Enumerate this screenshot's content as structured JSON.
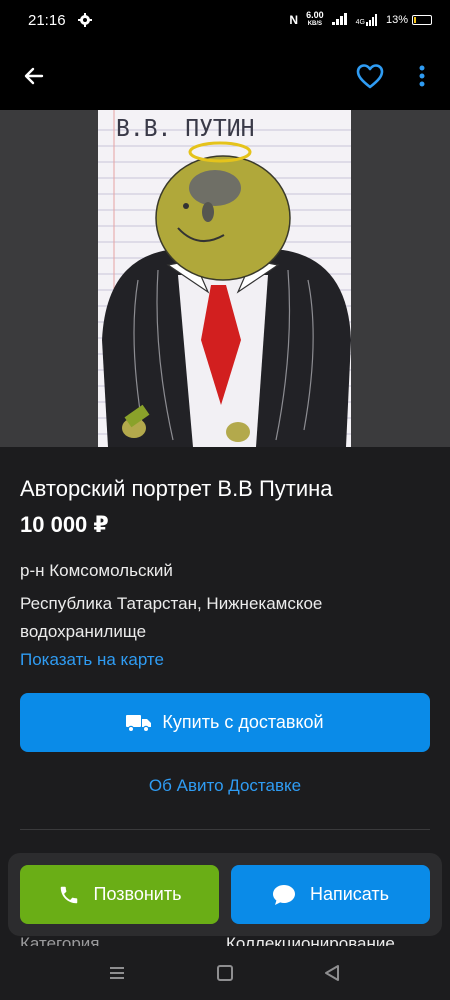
{
  "status_bar": {
    "time": "21:16",
    "net_speed_value": "6.00",
    "net_speed_unit": "KB/S",
    "network_type": "4G",
    "battery_percent": "13%",
    "battery_level": 0.13
  },
  "app_bar": {
    "back_icon": "arrow-left-icon",
    "favorite_icon": "heart-outline-icon",
    "more_icon": "more-vertical-icon",
    "accent_color": "#2f9cf3"
  },
  "photo": {
    "caption": "В.В. ПУТИН"
  },
  "listing": {
    "title": "Авторский портрет В.В Путина",
    "price": "10 000 ₽",
    "district": "р-н Комсомольский",
    "region": "Республика Татарстан, Нижнекамское водохранилище",
    "map_link": "Показать на карте"
  },
  "buy": {
    "label": "Купить с доставкой",
    "icon": "truck-icon",
    "color": "#0a8be8"
  },
  "delivery_link": "Об Авито Доставке",
  "params": {
    "category_label": "Категория",
    "category_value": "Коллекционирование"
  },
  "actions": {
    "call_label": "Позвонить",
    "call_icon": "phone-icon",
    "call_color": "#6aae16",
    "message_label": "Написать",
    "message_icon": "chat-bubble-icon",
    "message_color": "#0a8be8"
  },
  "system_nav": {
    "menu_icon": "menu-icon",
    "home_icon": "square-home-icon",
    "back_icon": "triangle-back-icon"
  }
}
